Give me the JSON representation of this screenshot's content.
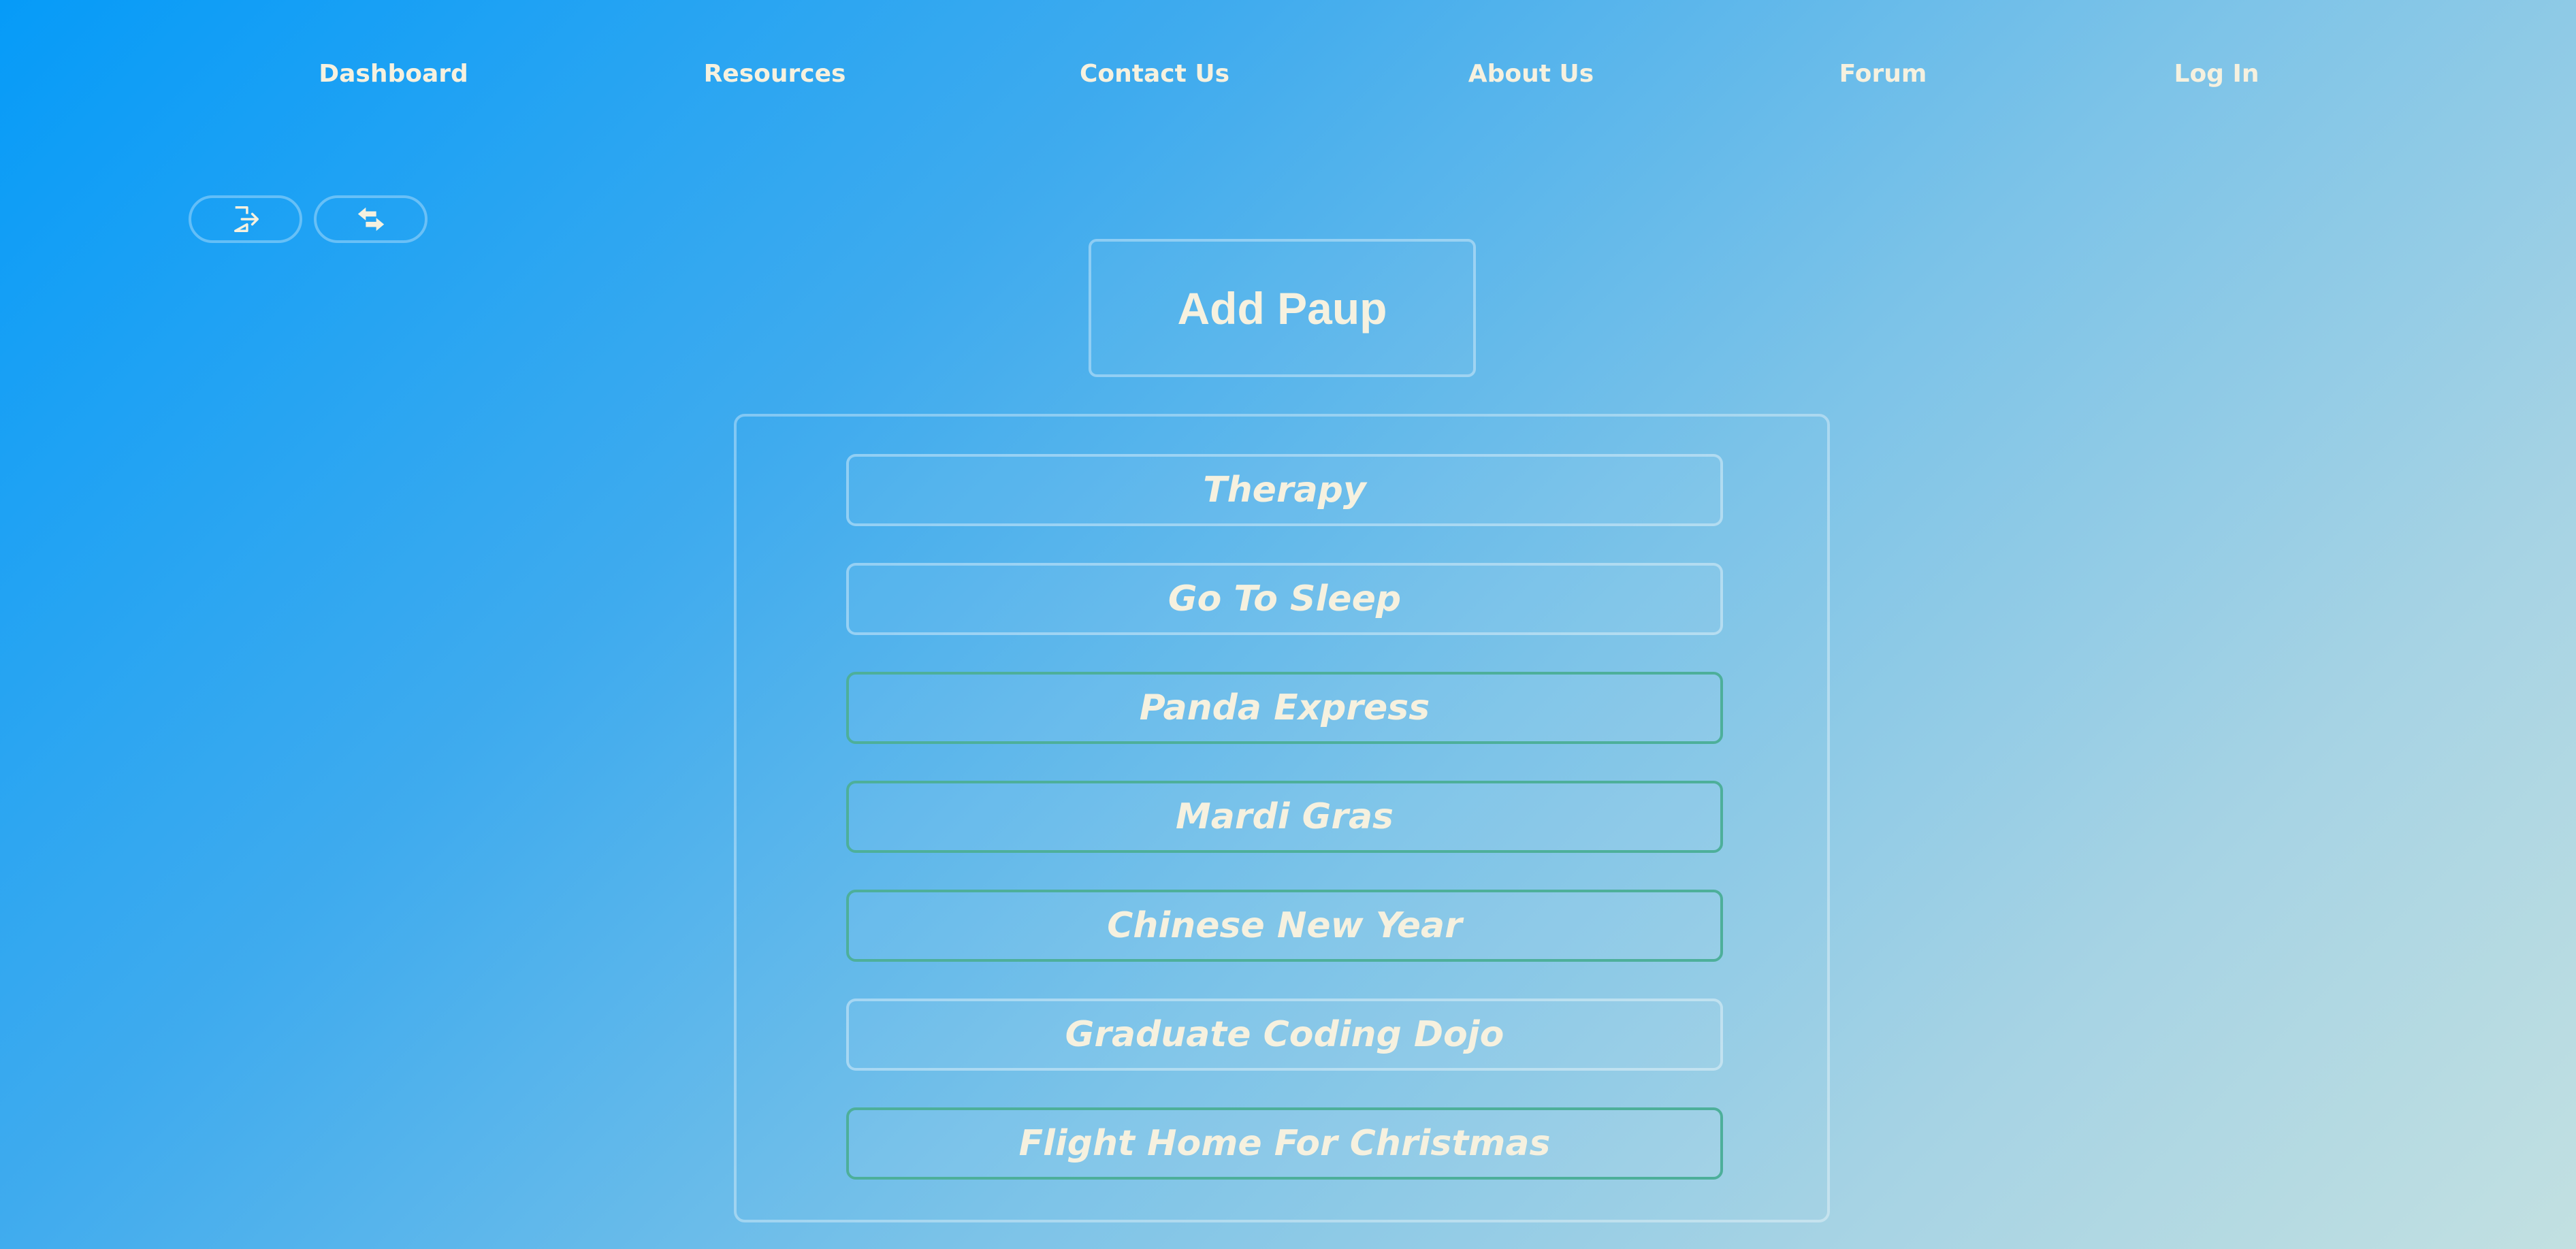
{
  "nav": {
    "links": [
      {
        "label": "Dashboard"
      },
      {
        "label": "Resources"
      },
      {
        "label": "Contact Us"
      },
      {
        "label": "About Us"
      },
      {
        "label": "Forum"
      },
      {
        "label": "Log In"
      }
    ]
  },
  "icons": {
    "logout": "logout-icon",
    "swap": "swap-arrows-icon"
  },
  "main": {
    "add_button_label": "Add Paup",
    "items": [
      {
        "label": "Therapy",
        "border": "light"
      },
      {
        "label": "Go To Sleep",
        "border": "light"
      },
      {
        "label": "Panda Express",
        "border": "green"
      },
      {
        "label": "Mardi Gras",
        "border": "green"
      },
      {
        "label": "Chinese New Year",
        "border": "green"
      },
      {
        "label": "Graduate Coding Dojo",
        "border": "light"
      },
      {
        "label": "Flight Home For Christmas",
        "border": "green"
      }
    ]
  },
  "colors": {
    "gradient_start": "#069bf8",
    "gradient_end": "#c2e0e1",
    "text": "#f6f1df",
    "green_border": "#4daf9a"
  }
}
